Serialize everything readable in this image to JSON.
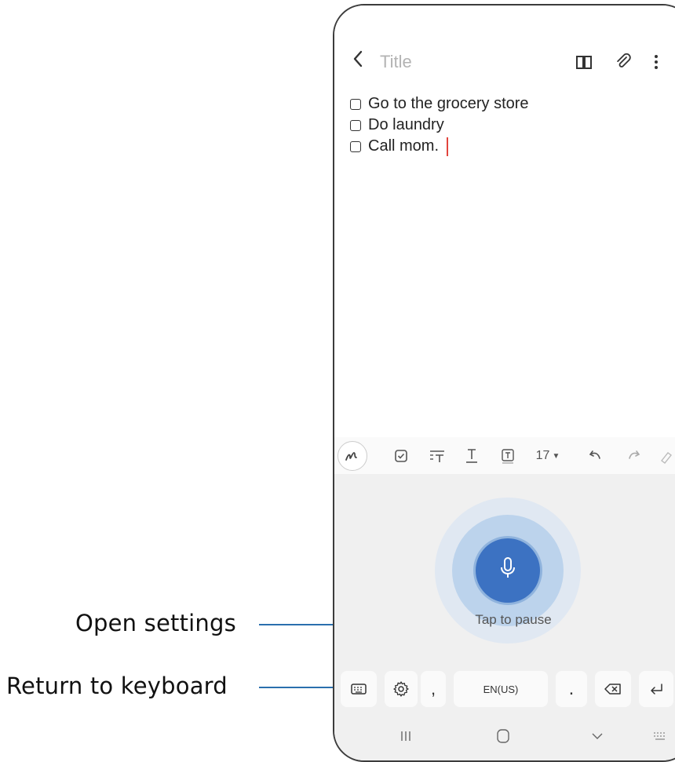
{
  "callouts": {
    "open_settings": "Open settings",
    "return_keyboard": "Return to keyboard"
  },
  "note": {
    "back_icon": "chevron-left-icon",
    "title_placeholder": "Title",
    "header_icons": [
      "book-icon",
      "paperclip-icon",
      "more-vertical-icon"
    ],
    "items": [
      {
        "text": "Go to the grocery store",
        "checked": false
      },
      {
        "text": "Do laundry",
        "checked": false
      },
      {
        "text": "Call mom.",
        "checked": false
      }
    ]
  },
  "toolbar": {
    "icons": [
      "pen-icon",
      "checkbox-icon",
      "text-spacing-icon",
      "underline-icon",
      "text-box-icon",
      "undo-icon",
      "redo-icon",
      "eraser-icon"
    ],
    "font_size": "17"
  },
  "voice": {
    "status": "Tap to pause",
    "mic_icon": "microphone-icon"
  },
  "keyboard": {
    "comma": ",",
    "language": "EN(US)",
    "period": ".",
    "keys_icons": [
      "keyboard-icon",
      "gear-icon",
      "backspace-icon",
      "enter-icon"
    ]
  },
  "navbar": {
    "icons": [
      "recents-icon",
      "home-icon",
      "back-down-icon",
      "keyboard-grid-icon"
    ]
  },
  "colors": {
    "accent": "#3c72c2",
    "callout_line": "#2a6fae",
    "cursor": "#e2443d"
  }
}
